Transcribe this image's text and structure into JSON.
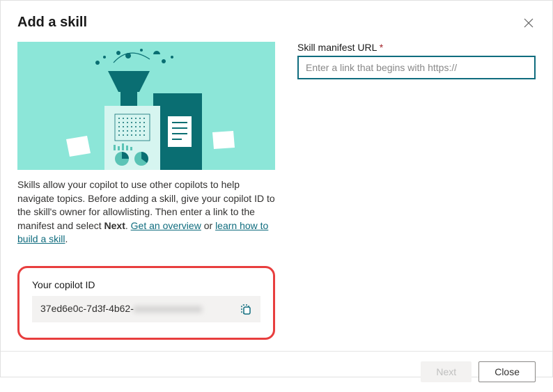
{
  "header": {
    "title": "Add a skill"
  },
  "description": {
    "text_start": "Skills allow your copilot to use other copilots to help navigate topics. Before adding a skill, give your copilot ID to the skill's owner for allowlisting. Then enter a link to the manifest and select ",
    "next_word": "Next",
    "period_space": ". ",
    "link_overview": "Get an overview",
    "separator": " or ",
    "link_learn": "learn how to build a skill",
    "period": "."
  },
  "copilot_id": {
    "label": "Your copilot ID",
    "value_visible": "37ed6e0c-7d3f-4b62-",
    "value_hidden": "xxxxxxxxxxxxxx"
  },
  "form": {
    "url_label": "Skill manifest URL",
    "required_mark": "*",
    "url_placeholder": "Enter a link that begins with https://"
  },
  "footer": {
    "next": "Next",
    "close": "Close"
  }
}
